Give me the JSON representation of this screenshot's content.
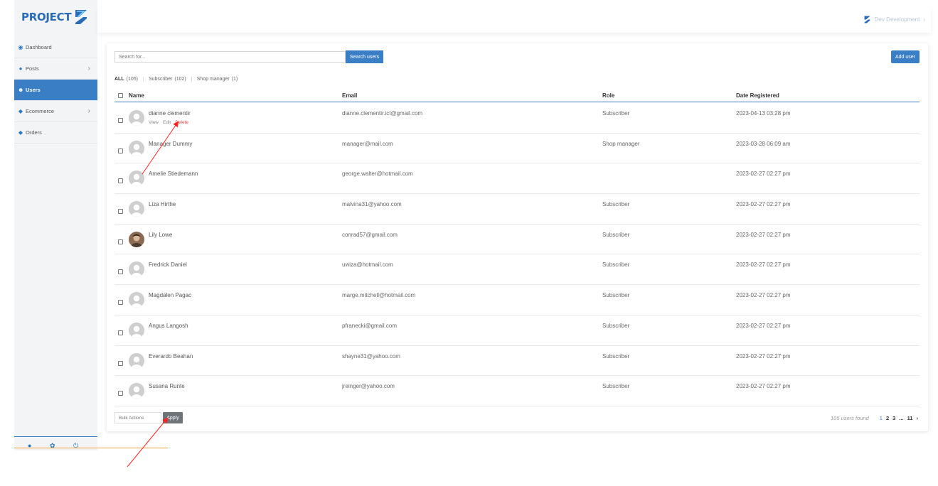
{
  "brand": {
    "logo_text": "PROJECT",
    "accent": "#3a7fc6"
  },
  "topbar": {
    "account_label": "Dev Development",
    "chevron": "›"
  },
  "sidebar": {
    "items": [
      {
        "label": "Dashboard",
        "icon": "dashboard-icon",
        "glyph": "◉",
        "chevron": ""
      },
      {
        "label": "Posts",
        "icon": "pin-icon",
        "glyph": "●",
        "chevron": "›"
      },
      {
        "label": "Users",
        "icon": "users-icon",
        "glyph": "☻",
        "chevron": ""
      },
      {
        "label": "Ecommerce",
        "icon": "tag-icon",
        "glyph": "◆",
        "chevron": "›"
      },
      {
        "label": "Orders",
        "icon": "tag-icon",
        "glyph": "◆",
        "chevron": ""
      }
    ],
    "bottom_icons": [
      "user-icon",
      "settings-icon",
      "power-icon"
    ]
  },
  "search": {
    "placeholder": "Search for...",
    "button_label": "Search users"
  },
  "add_user_label": "Add user",
  "filters": [
    {
      "label": "ALL",
      "count": "(105)"
    },
    {
      "label": "Subscriber",
      "count": "(102)"
    },
    {
      "label": "Shop manager",
      "count": "(1)"
    }
  ],
  "table": {
    "headers": {
      "name": "Name",
      "email": "Email",
      "role": "Role",
      "date": "Date Registered"
    },
    "row_actions": {
      "view": "View",
      "edit": "Edit",
      "delete": "Delete"
    },
    "rows": [
      {
        "name": "dianne clementir",
        "email": "dianne.clementir.ict@gmail.com",
        "role": "Subscriber",
        "date": "2023-04-13 03:28 pm"
      },
      {
        "name": "Manager Dummy",
        "email": "manager@mail.com",
        "role": "Shop manager",
        "date": "2023-03-28 06:09 am"
      },
      {
        "name": "Amelie Stiedemann",
        "email": "george.walter@hotmail.com",
        "role": "",
        "date": "2023-02-27 02:27 pm"
      },
      {
        "name": "Liza Hirthe",
        "email": "malvina31@yahoo.com",
        "role": "Subscriber",
        "date": "2023-02-27 02:27 pm"
      },
      {
        "name": "Lily Lowe",
        "email": "conrad57@gmail.com",
        "role": "Subscriber",
        "date": "2023-02-27 02:27 pm"
      },
      {
        "name": "Fredrick Daniel",
        "email": "uwiza@hotmail.com",
        "role": "Subscriber",
        "date": "2023-02-27 02:27 pm"
      },
      {
        "name": "Magdalen Pagac",
        "email": "marge.mitchell@hotmail.com",
        "role": "Subscriber",
        "date": "2023-02-27 02:27 pm"
      },
      {
        "name": "Angus Langosh",
        "email": "pfranecki@gmail.com",
        "role": "Subscriber",
        "date": "2023-02-27 02:27 pm"
      },
      {
        "name": "Everardo Beahan",
        "email": "shayne31@yahoo.com",
        "role": "Subscriber",
        "date": "2023-02-27 02:27 pm"
      },
      {
        "name": "Susana Runte",
        "email": "jreinger@yahoo.com",
        "role": "Subscriber",
        "date": "2023-02-27 02:27 pm"
      }
    ]
  },
  "footer": {
    "bulk_actions_label": "Bulk Actions",
    "apply_label": "Apply",
    "users_found": "105 users found",
    "pages": [
      "1",
      "2",
      "3",
      "...",
      "11",
      "›"
    ]
  }
}
